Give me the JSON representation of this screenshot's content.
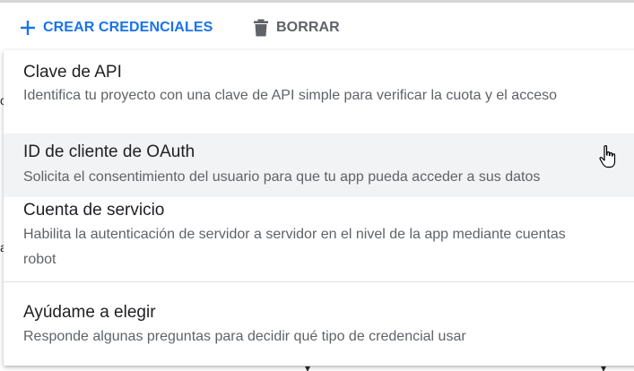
{
  "toolbar": {
    "create_label": "CREAR CREDENCIALES",
    "delete_label": "BORRAR",
    "create_icon": "plus-icon",
    "delete_icon": "trash-icon",
    "accent_color": "#1a73e8"
  },
  "menu": {
    "items": [
      {
        "title": "Clave de API",
        "description": "Identifica tu proyecto con una clave de API simple para verificar la cuota y el acceso"
      },
      {
        "title": "ID de cliente de OAuth",
        "description": "Solicita el consentimiento del usuario para que tu app pueda acceder a sus datos"
      },
      {
        "title": "Cuenta de servicio",
        "description": "Habilita la autenticación de servidor a servidor en el nivel de la app mediante cuentas robot"
      },
      {
        "title": "Ayúdame a elegir",
        "description": "Responde algunas preguntas para decidir qué tipo de credencial usar"
      }
    ]
  }
}
